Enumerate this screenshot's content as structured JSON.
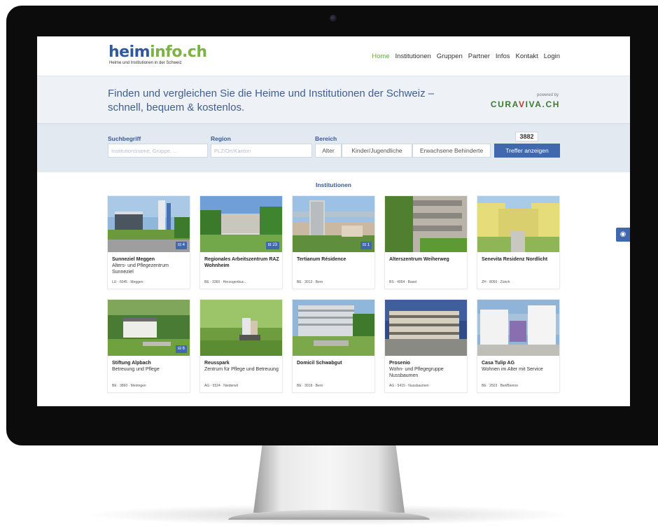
{
  "header": {
    "logo_part1": "heim",
    "logo_part2": "info.ch",
    "logo_subtitle": "Heime und Institutionen in der Schweiz",
    "nav": [
      {
        "label": "Home",
        "active": true
      },
      {
        "label": "Institutionen",
        "active": false
      },
      {
        "label": "Gruppen",
        "active": false
      },
      {
        "label": "Partner",
        "active": false
      },
      {
        "label": "Infos",
        "active": false
      },
      {
        "label": "Kontakt",
        "active": false
      },
      {
        "label": "Login",
        "active": false
      }
    ]
  },
  "hero": {
    "title_line1": "Finden und vergleichen Sie die Heime und Institutionen der Schweiz –",
    "title_line2": "schnell, bequem & kostenlos.",
    "powered_by": "powered by",
    "partner_logo_a": "CURA",
    "partner_logo_v": "V",
    "partner_logo_b": "IVA.CH"
  },
  "search": {
    "term_label": "Suchbegriff",
    "term_placeholder": "Institutionsname, Gruppe, ...",
    "region_label": "Region",
    "region_placeholder": "PLZ/Ort/Kanton",
    "area_label": "Bereich",
    "areas": [
      "Alter",
      "Kinder/Jugendliche",
      "Erwachsene Behinderte"
    ],
    "result_count": "3882",
    "submit_label": "Treffer anzeigen"
  },
  "results": {
    "title": "Institutionen",
    "cards": [
      {
        "name": "Sunneziel Meggen",
        "sub": "Alters- und Pflegezentrum Sunneziel",
        "loc": "LU · 6045 · Meggen",
        "badge": "4"
      },
      {
        "name": "Regionales Arbeitszentrum RAZ Wohnheim",
        "sub": "",
        "loc": "BE · 3360 · Herzogenbuc...",
        "badge": "23"
      },
      {
        "name": "Tertianum Résidence",
        "sub": "",
        "loc": "BE · 3012 · Bern",
        "badge": "1"
      },
      {
        "name": "Alterszentrum Weiherweg",
        "sub": "",
        "loc": "BS · 4054 · Basel",
        "badge": ""
      },
      {
        "name": "Senevita Residenz Nordlicht",
        "sub": "",
        "loc": "ZH · 8050 · Zürich",
        "badge": ""
      },
      {
        "name": "Stiftung Alpbach",
        "sub": "Betreuung und Pflege",
        "loc": "BE · 3860 · Meiringen",
        "badge": "6"
      },
      {
        "name": "Reusspark",
        "sub": "Zentrum für Pflege und Betreuung",
        "loc": "AG · 5524 · Niederwil",
        "badge": ""
      },
      {
        "name": "Domicil Schwabgut",
        "sub": "",
        "loc": "BE · 3018 · Bern",
        "badge": ""
      },
      {
        "name": "Prosenio",
        "sub": "Wohn- und Pflegegruppe Nussbaumen",
        "loc": "AG · 5415 · Nussbaumen",
        "badge": ""
      },
      {
        "name": "Casa Tulip AG",
        "sub": "Wohnen im Alter mit Service",
        "loc": "BE · 2503 · Biel/Bienne",
        "badge": ""
      }
    ]
  },
  "colors": {
    "brand_blue": "#2f5aa3",
    "brand_green": "#7cb342",
    "button_blue": "#3f68ae",
    "nav_active": "#6aa84f"
  },
  "icons": {
    "side_tab": "eye-icon",
    "badge": "bed-icon"
  }
}
